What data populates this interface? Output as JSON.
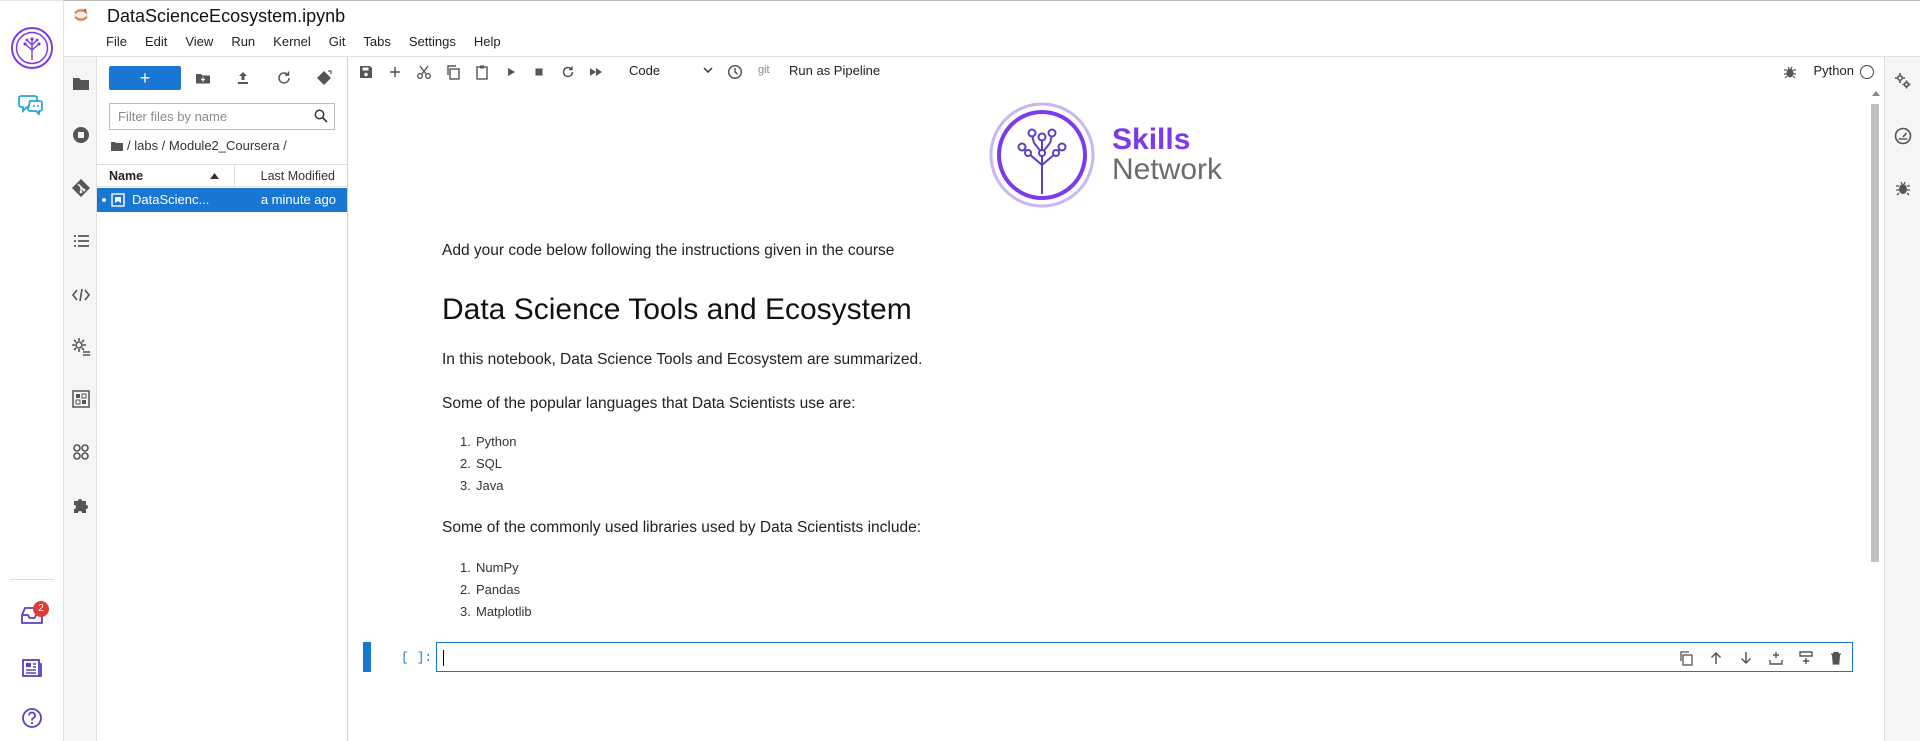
{
  "app": {
    "document_title": "DataScienceEcosystem.ipynb",
    "menu": [
      "File",
      "Edit",
      "View",
      "Run",
      "Kernel",
      "Git",
      "Tabs",
      "Settings",
      "Help"
    ],
    "notification_count": "2"
  },
  "filebrowser": {
    "new_label": "+",
    "filter_placeholder": "Filter files by name",
    "breadcrumb": "/ labs / Module2_Coursera /",
    "col_name": "Name",
    "col_modified": "Last Modified",
    "files": [
      {
        "name": "DataScienc...",
        "modified": "a minute ago",
        "selected": true
      }
    ]
  },
  "toolbar": {
    "cell_type": "Code",
    "git_label": "git",
    "pipeline_label": "Run as Pipeline",
    "kernel_name": "Python"
  },
  "notebook": {
    "logo_line1": "Skills",
    "logo_line2": "Network",
    "instruction": "Add your code below following the instructions given in the course",
    "heading": "Data Science Tools and Ecosystem",
    "intro": "In this notebook, Data Science Tools and Ecosystem are summarized.",
    "languages_intro": "Some of the popular languages that Data Scientists use are:",
    "languages": [
      "Python",
      "SQL",
      "Java"
    ],
    "libraries_intro": "Some of the commonly used libraries used by Data Scientists include:",
    "libraries": [
      "NumPy",
      "Pandas",
      "Matplotlib"
    ],
    "code_prompt": "[ ]:"
  },
  "colors": {
    "accent": "#1976d2",
    "brand_purple": "#7c3aed",
    "badge_red": "#e53935"
  }
}
